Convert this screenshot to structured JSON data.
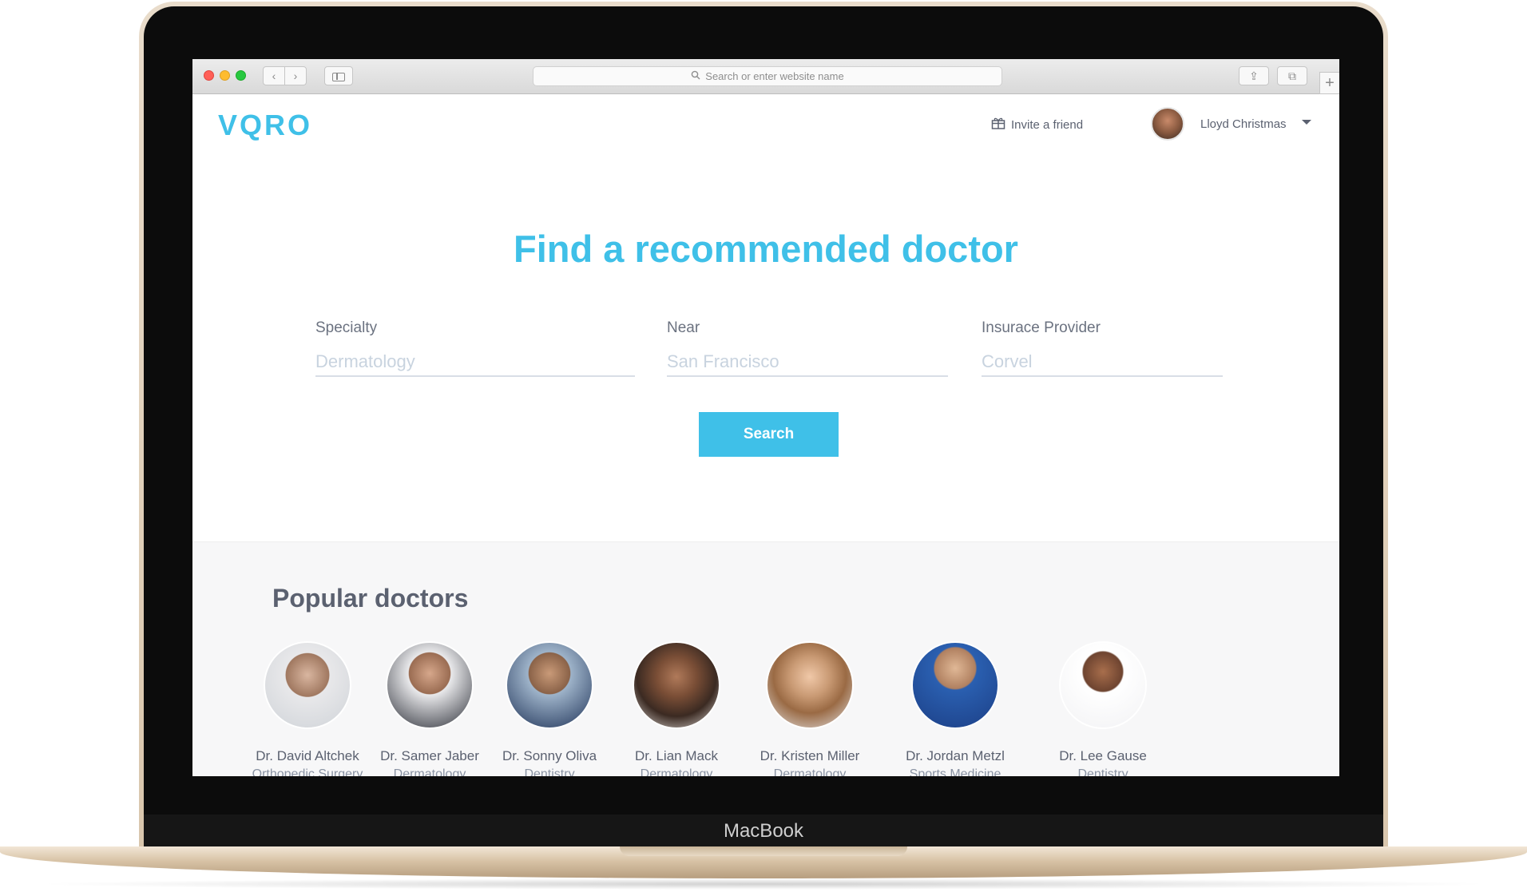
{
  "laptop": {
    "brand_label": "MacBook"
  },
  "browser": {
    "address_placeholder": "Search or enter website name",
    "back_glyph": "‹",
    "forward_glyph": "›",
    "new_tab_glyph": "+",
    "share_glyph": "⇪",
    "tabs_glyph": "⧉"
  },
  "header": {
    "logo": "VQRO",
    "invite_label": "Invite a friend",
    "user_name": "Lloyd Christmas"
  },
  "hero": {
    "title": "Find a recommended doctor",
    "fields": [
      {
        "label": "Specialty",
        "placeholder": "Dermatology"
      },
      {
        "label": "Near",
        "placeholder": "San Francisco"
      },
      {
        "label": "Insurace Provider",
        "placeholder": "Corvel"
      }
    ],
    "search_label": "Search"
  },
  "popular": {
    "title": "Popular doctors",
    "doctors": [
      {
        "name": "Dr. David Altchek",
        "specialty": "Orthopedic Surgery"
      },
      {
        "name": "Dr. Samer Jaber",
        "specialty": "Dermatology"
      },
      {
        "name": "Dr. Sonny Oliva",
        "specialty": "Dentistry"
      },
      {
        "name": "Dr. Lian Mack",
        "specialty": "Dermatology"
      },
      {
        "name": "Dr. Kristen Miller",
        "specialty": "Dermatology"
      },
      {
        "name": "Dr. Jordan Metzl",
        "specialty": "Sports Medicine"
      },
      {
        "name": "Dr. Lee Gause",
        "specialty": "Dentistry"
      }
    ]
  },
  "colors": {
    "accent": "#3fc0e8",
    "text": "#5b6170",
    "muted": "#8a93a3",
    "section_bg": "#f7f7f8"
  },
  "icons": [
    "search-icon",
    "gift-icon",
    "chevron-down-icon",
    "sidebar-icon",
    "share-icon",
    "tabs-icon",
    "plus-icon"
  ]
}
